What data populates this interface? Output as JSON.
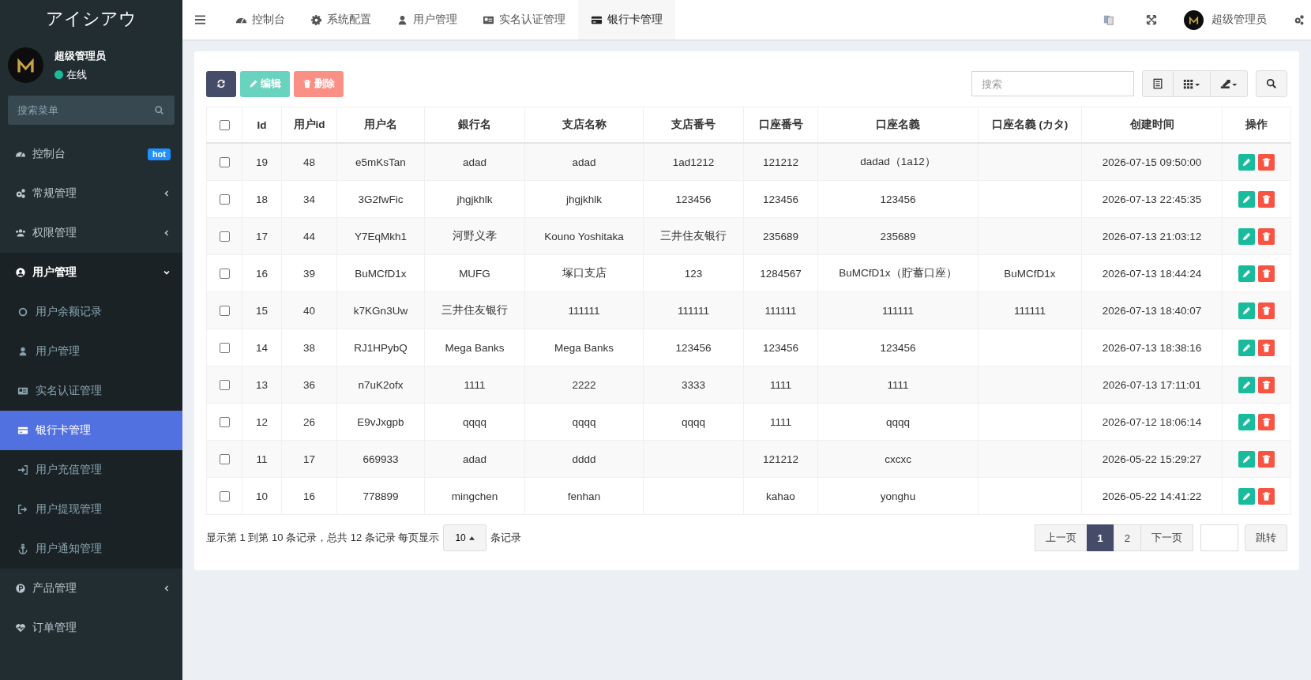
{
  "sidebar": {
    "logo": "アイシアウ",
    "user": {
      "name": "超级管理员",
      "status": "在线"
    },
    "search": {
      "placeholder": "搜索菜单"
    },
    "items": [
      {
        "label": "控制台",
        "badge": "hot",
        "selected": false
      },
      {
        "label": "常规管理",
        "expanded": false,
        "selected": false
      },
      {
        "label": "权限管理",
        "expanded": false,
        "selected": false
      },
      {
        "label": "用户管理",
        "expanded": true,
        "selected": false,
        "children": [
          {
            "label": "用户余额记录",
            "selected": false
          },
          {
            "label": "用户管理",
            "selected": false
          },
          {
            "label": "实名认证管理",
            "selected": false
          },
          {
            "label": "银行卡管理",
            "selected": true
          },
          {
            "label": "用户充值管理",
            "selected": false
          },
          {
            "label": "用户提现管理",
            "selected": false
          },
          {
            "label": "用户通知管理",
            "selected": false
          }
        ]
      },
      {
        "label": "产品管理",
        "expanded": false,
        "selected": false
      },
      {
        "label": "订单管理",
        "selected": false
      }
    ]
  },
  "tabs": [
    {
      "label": "控制台",
      "selected": false
    },
    {
      "label": "系统配置",
      "selected": false
    },
    {
      "label": "用户管理",
      "selected": false
    },
    {
      "label": "实名认证管理",
      "selected": false
    },
    {
      "label": "银行卡管理",
      "selected": true
    }
  ],
  "header": {
    "user_name": "超级管理员"
  },
  "toolbar": {
    "buttons": [
      {
        "kind": "refresh",
        "disabled": false
      },
      {
        "kind": "edit",
        "label": "编辑",
        "disabled": true
      },
      {
        "kind": "delete",
        "label": "删除",
        "disabled": true
      }
    ],
    "search": {
      "placeholder": "搜索"
    }
  },
  "table": {
    "header_checked": false,
    "columns": [
      "Id",
      "用户id",
      "用户名",
      "銀行名",
      "支店名称",
      "支店番号",
      "口座番号",
      "口座名義",
      "口座名義 (カタ)",
      "创建时间",
      "操作"
    ],
    "rows": [
      {
        "checked": false,
        "id": "19",
        "user_id": "48",
        "username": "e5mKsTan",
        "bank": "adad",
        "branch": "adad",
        "branch_no": "1ad1212",
        "account_no": "121212",
        "account_name": "dadad（1a12）",
        "created": "2026-07-15 09:50:00"
      },
      {
        "checked": false,
        "id": "18",
        "user_id": "34",
        "username": "3G2fwFic",
        "bank": "jhgjkhlk",
        "branch": "jhgjkhlk",
        "branch_no": "123456",
        "account_no": "123456",
        "account_name": "123456",
        "created": "2026-07-13 22:45:35"
      },
      {
        "checked": false,
        "id": "17",
        "user_id": "44",
        "username": "Y7EqMkh1",
        "bank": "河野义孝",
        "branch": "Kouno Yoshitaka",
        "branch_no": "三井住友银行",
        "account_no": "235689",
        "account_name": "235689",
        "created": "2026-07-13 21:03:12"
      },
      {
        "checked": false,
        "id": "16",
        "user_id": "39",
        "username": "BuMCfD1x",
        "bank": "MUFG",
        "branch": "塚口支店",
        "branch_no": "123",
        "account_no": "1284567",
        "account_name": "BuMCfD1x（貯蓄口座）",
        "account_name_kana": "BuMCfD1x",
        "created": "2026-07-13 18:44:24"
      },
      {
        "checked": false,
        "id": "15",
        "user_id": "40",
        "username": "k7KGn3Uw",
        "bank": "三井住友银行",
        "branch": "111111",
        "branch_no": "111111",
        "account_no": "111111",
        "account_name": "111111",
        "account_name_kana": "111111",
        "created": "2026-07-13 18:40:07"
      },
      {
        "checked": false,
        "id": "14",
        "user_id": "38",
        "username": "RJ1HPybQ",
        "bank": "Mega Banks",
        "branch": "Mega Banks",
        "branch_no": "123456",
        "account_no": "123456",
        "account_name": "123456",
        "created": "2026-07-13 18:38:16"
      },
      {
        "checked": false,
        "id": "13",
        "user_id": "36",
        "username": "n7uK2ofx",
        "bank": "1111",
        "branch": "2222",
        "branch_no": "3333",
        "account_no": "1111",
        "account_name": "1111",
        "created": "2026-07-13 17:11:01"
      },
      {
        "checked": false,
        "id": "12",
        "user_id": "26",
        "username": "E9vJxgpb",
        "bank": "qqqq",
        "branch": "qqqq",
        "branch_no": "qqqq",
        "account_no": "1111",
        "account_name": "qqqq",
        "created": "2026-07-12 18:06:14"
      },
      {
        "checked": false,
        "id": "11",
        "user_id": "17",
        "username": "669933",
        "bank": "adad",
        "branch": "dddd",
        "account_no": "121212",
        "account_name": "cxcxc",
        "created": "2026-05-22 15:29:27"
      },
      {
        "checked": false,
        "id": "10",
        "user_id": "16",
        "username": "778899",
        "bank": "mingchen",
        "branch": "fenhan",
        "account_no": "kahao",
        "account_name": "yonghu",
        "created": "2026-05-22 14:41:22"
      }
    ]
  },
  "footer": {
    "summary": "显示第 1 到第 10 条记录，总共 12 条记录 每页显示",
    "page_size": "10",
    "suffix": "条记录",
    "prev": "上一页",
    "pages": [
      {
        "label": "1",
        "selected": true
      },
      {
        "label": "2",
        "selected": false
      }
    ],
    "next": "下一页",
    "jump": "跳转"
  }
}
